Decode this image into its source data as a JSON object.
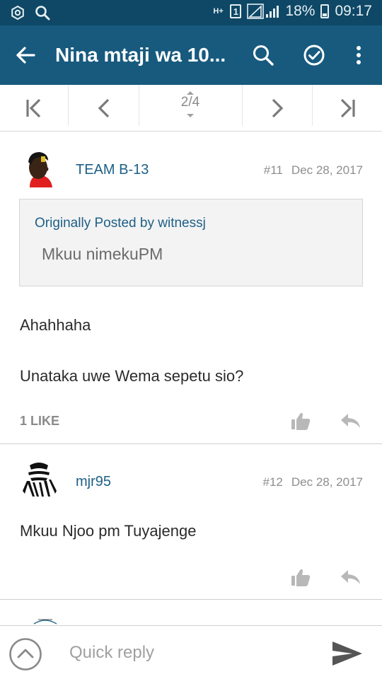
{
  "status_bar": {
    "network": "H+",
    "sim": "1",
    "battery": "18%",
    "time": "09:17"
  },
  "app_bar": {
    "title": "Nina mtaji wa 10..."
  },
  "pager": {
    "current_page": "2",
    "total_pages": "4"
  },
  "posts": [
    {
      "username": "TEAM B-13",
      "post_number": "#11",
      "date": "Dec 28, 2017",
      "quote": {
        "header": "Originally Posted by witnessj",
        "text": "Mkuu nimekuPM"
      },
      "body": [
        "Ahahhaha",
        "Unataka uwe Wema sepetu sio?"
      ],
      "likes": "1 LIKE"
    },
    {
      "username": "mjr95",
      "post_number": "#12",
      "date": "Dec 28, 2017",
      "body": [
        "Mkuu Njoo pm Tuyajenge"
      ]
    }
  ],
  "quick_reply": {
    "placeholder": "Quick reply"
  },
  "colors": {
    "status_bar": "#0e4866",
    "app_bar": "#175a7e",
    "link": "#1d5f86"
  },
  "icons": [
    "settings-icon",
    "search-icon",
    "sim-icon",
    "signal-icon",
    "battery-icon",
    "back-arrow-icon",
    "check-circle-icon",
    "more-vert-icon",
    "first-page-icon",
    "prev-page-icon",
    "next-page-icon",
    "last-page-icon",
    "thumbs-up-icon",
    "reply-icon",
    "chevron-up-circle-icon",
    "send-icon"
  ]
}
